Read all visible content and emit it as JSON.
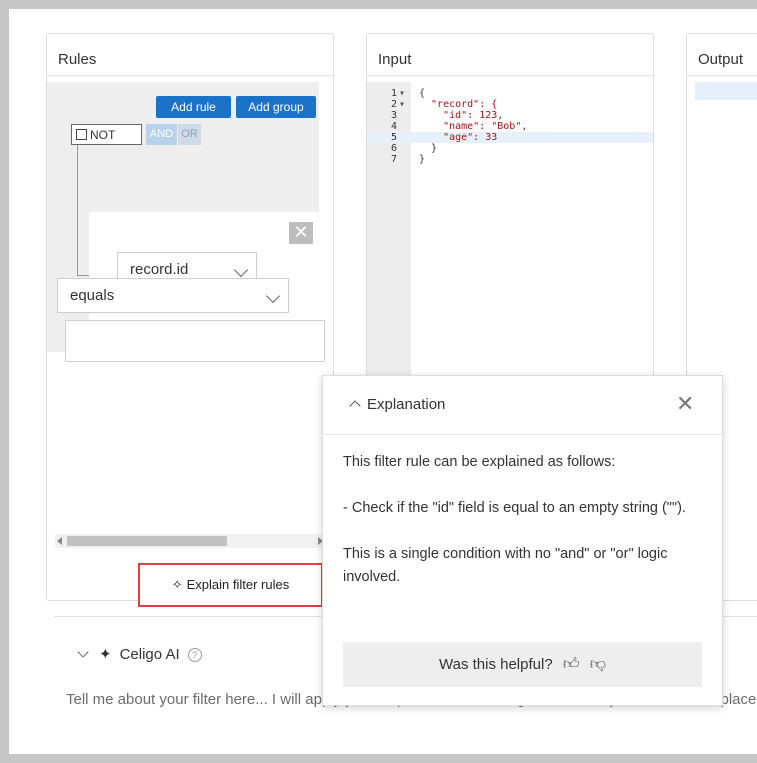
{
  "rules": {
    "title": "Rules",
    "add_rule_label": "Add rule",
    "add_group_label": "Add group",
    "not_label": "NOT",
    "and_label": "AND",
    "or_label": "OR",
    "field_value": "record.id",
    "operator_value": "equals",
    "value_input": "",
    "explain_button_label": "Explain filter rules"
  },
  "input": {
    "title": "Input",
    "code_lines": [
      {
        "n": "1",
        "text": "{"
      },
      {
        "n": "2",
        "text": "  \"record\": {"
      },
      {
        "n": "3",
        "text": "    \"id\": 123,"
      },
      {
        "n": "4",
        "text": "    \"name\": \"Bob\","
      },
      {
        "n": "5",
        "text": "    \"age\": 33"
      },
      {
        "n": "6",
        "text": "  }"
      },
      {
        "n": "7",
        "text": "}"
      }
    ]
  },
  "output": {
    "title": "Output"
  },
  "celigo_ai": {
    "title": "Celigo AI",
    "prompt_placeholder": "Tell me about your filter here... I will apply your request to the existing filter unless you ask me to replace it."
  },
  "explanation": {
    "title": "Explanation",
    "line1": "This filter rule can be explained as follows:",
    "line2": "- Check if the \"id\" field is equal to an empty string (\"\").",
    "line3": "This is a single condition with no \"and\" or \"or\" logic involved.",
    "helpful_label": "Was this helpful?"
  },
  "colors": {
    "accent_blue": "#1a73c8",
    "highlight_red": "#e04040"
  }
}
